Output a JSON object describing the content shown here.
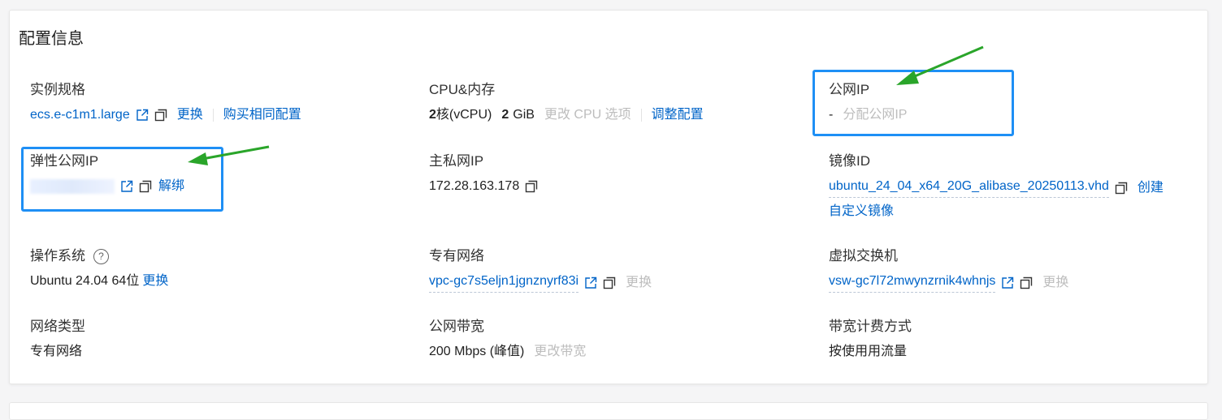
{
  "section_title": "配置信息",
  "instance_spec": {
    "label": "实例规格",
    "value": "ecs.e-c1m1.large",
    "change": "更换",
    "buy_same": "购买相同配置"
  },
  "cpu_mem": {
    "label": "CPU&内存",
    "cpu_num": "2",
    "cpu_unit": "核(vCPU)",
    "mem_num": "2",
    "mem_unit": "GiB",
    "change_cpu": "更改 CPU 选项",
    "adjust": "调整配置"
  },
  "public_ip": {
    "label": "公网IP",
    "value": "-",
    "assign": "分配公网IP"
  },
  "eip": {
    "label": "弹性公网IP",
    "unbind": "解绑"
  },
  "private_ip": {
    "label": "主私网IP",
    "value": "172.28.163.178"
  },
  "image_id": {
    "label": "镜像ID",
    "value": "ubuntu_24_04_x64_20G_alibase_20250113.vhd",
    "create": "创建",
    "custom": "自定义镜像"
  },
  "os": {
    "label": "操作系统",
    "help": "?",
    "value": "Ubuntu 24.04 64位",
    "change": "更换"
  },
  "vpc": {
    "label": "专有网络",
    "value": "vpc-gc7s5eljn1jgnznyrf83i",
    "change": "更换"
  },
  "vswitch": {
    "label": "虚拟交换机",
    "value": "vsw-gc7l72mwynzrnik4whnjs",
    "change": "更换"
  },
  "network_type": {
    "label": "网络类型",
    "value": "专有网络"
  },
  "bandwidth": {
    "label": "公网带宽",
    "value": "200 Mbps (峰值)",
    "change": "更改带宽"
  },
  "billing": {
    "label": "带宽计费方式",
    "value": "按使用用流量"
  },
  "colors": {
    "link": "#0064c8",
    "disabled": "#bdbdbd",
    "highlight": "#1e8ff5",
    "arrow": "#2aa52a"
  }
}
